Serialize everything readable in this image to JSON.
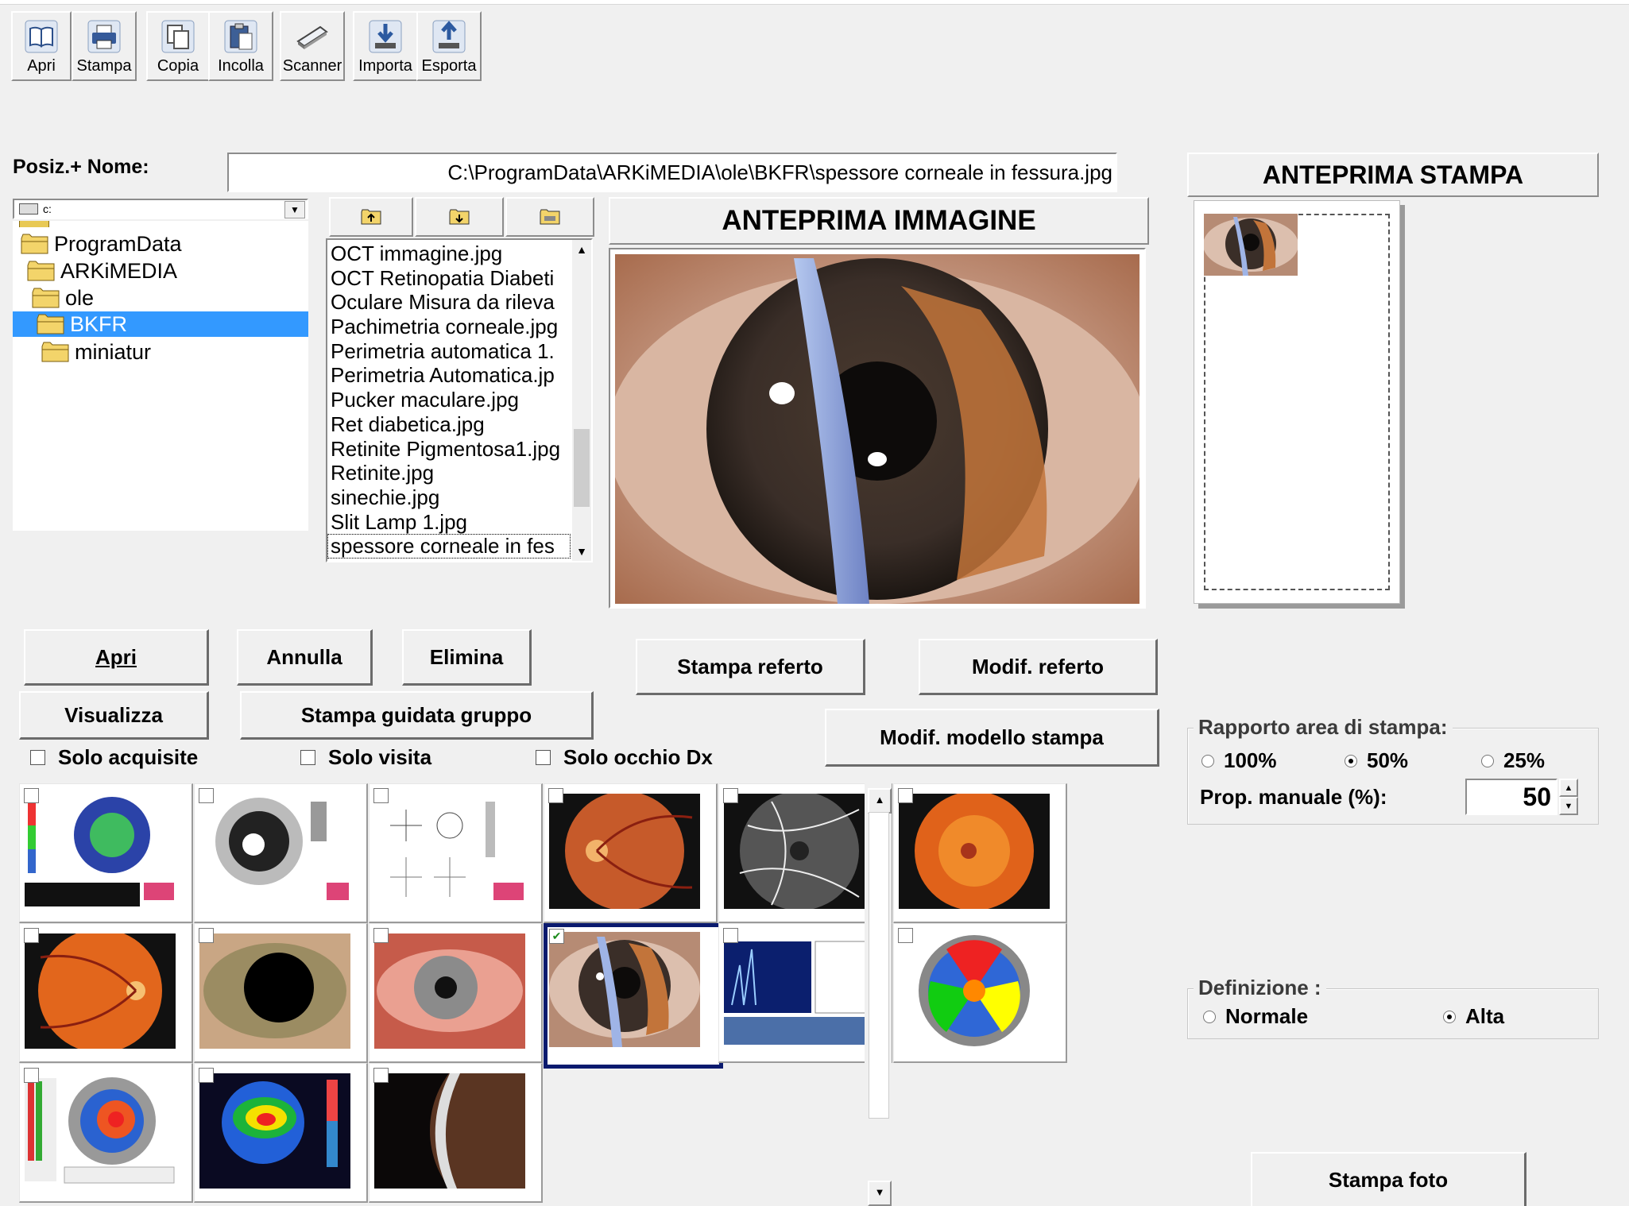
{
  "toolbar": [
    {
      "label": "Apri",
      "icon": "open-book-icon"
    },
    {
      "label": "Stampa",
      "icon": "printer-icon"
    },
    {
      "label": "Copia",
      "icon": "copy-icon"
    },
    {
      "label": "Incolla",
      "icon": "paste-icon"
    },
    {
      "label": "Scanner",
      "icon": "scanner-icon"
    },
    {
      "label": "Importa",
      "icon": "import-icon"
    },
    {
      "label": "Esporta",
      "icon": "export-icon"
    }
  ],
  "path": {
    "label": "Posiz.+ Nome:",
    "value": "C:\\ProgramData\\ARKiMEDIA\\ole\\BKFR\\spessore corneale in fessura.jpg"
  },
  "drive": {
    "value": "c:"
  },
  "tree": [
    {
      "name": "ProgramData"
    },
    {
      "name": "ARKiMEDIA"
    },
    {
      "name": "ole"
    },
    {
      "name": "BKFR"
    },
    {
      "name": "miniatur"
    }
  ],
  "files": [
    "OCT immagine.jpg",
    "OCT Retinopatia Diabeti",
    "Oculare Misura da rileva",
    "Pachimetria corneale.jpg",
    "Perimetria automatica 1.",
    "Perimetria Automatica.jp",
    "Pucker maculare.jpg",
    "Ret diabetica.jpg",
    "Retinite Pigmentosa1.jpg",
    "Retinite.jpg",
    "sinechie.jpg",
    "Slit Lamp 1.jpg",
    "spessore corneale in fes"
  ],
  "preview": {
    "title": "ANTEPRIMA IMMAGINE"
  },
  "print_preview": {
    "title": "ANTEPRIMA STAMPA"
  },
  "buttons": {
    "apri": "Apri",
    "annulla": "Annulla",
    "elimina": "Elimina",
    "visualizza": "Visualizza",
    "stampa_guidata": "Stampa guidata gruppo",
    "stampa_referto": "Stampa referto",
    "modif_referto": "Modif. referto",
    "modif_modello": "Modif. modello stampa",
    "stampa_foto": "Stampa foto"
  },
  "filters": {
    "solo_acquisite": "Solo acquisite",
    "solo_visita": "Solo visita",
    "solo_occhio": "Solo occhio Dx"
  },
  "rapporto": {
    "title": "Rapporto area di stampa:",
    "opt100": "100%",
    "opt50": "50%",
    "opt25": "25%",
    "selected": "50%",
    "manual_label": "Prop. manuale (%):",
    "manual_value": "50"
  },
  "definizione": {
    "title": "Definizione :",
    "normale": "Normale",
    "alta": "Alta",
    "selected": "Alta"
  }
}
